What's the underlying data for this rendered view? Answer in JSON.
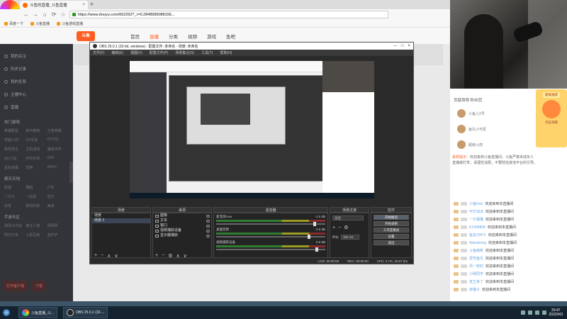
{
  "browser": {
    "tab_title": "斗鱼的直播_斗鱼直播",
    "tab_close": "×",
    "new_tab": "+",
    "url": "https://www.douyu.com/662262?_r=0.2848989088156...",
    "nav": {
      "back": "←",
      "forward": "→",
      "reload": "⟳",
      "home": "⌂",
      "star": "☆"
    },
    "bookmarks": [
      "百度一下",
      "斗鱼直播",
      "斗鱼游戏直播"
    ],
    "logo_caption": "斗鱼直播"
  },
  "site": {
    "logo": "斗鱼",
    "nav": [
      "首页",
      "直播",
      "分类",
      "视频",
      "游戏",
      "鱼吧"
    ],
    "active_nav": "直播"
  },
  "sidebar": {
    "items": [
      "我的关注",
      "历史记录",
      "我的任务",
      "主播中心",
      "直播"
    ],
    "section_1": "热门游戏",
    "grid_1": [
      "英雄联盟",
      "和平精英",
      "王者荣耀",
      "穿越火线",
      "CF手游",
      "DOTA2",
      "绝地求生",
      "主机游戏",
      "魔兽世界",
      "QQ飞车",
      "炉石传说",
      "DNF",
      "星际争霸",
      "原神",
      "APEX"
    ],
    "section_2": "娱乐天地",
    "grid_2": [
      "颜值",
      "舞蹈",
      "户外",
      "二次元",
      "一起看",
      "音乐",
      "体育",
      "数码科技",
      "美食"
    ],
    "section_3": "手游专区",
    "grid_3": [
      "球球大作战",
      "第五人格",
      "阴阳师",
      "明日方舟",
      "火影忍者",
      "金铲铲"
    ],
    "bottom_buttons": [
      "打开客户端",
      "下载"
    ]
  },
  "obs": {
    "title": "OBS 25.0.1 (32-bit, windows) - 配置文件: 未命名 - 场景: 未命名",
    "window_buttons": [
      "─",
      "□",
      "×"
    ],
    "menu": [
      "文件(F)",
      "编辑(E)",
      "视图(V)",
      "配置文件(P)",
      "场景集合(S)",
      "工具(T)",
      "帮助(H)"
    ],
    "docks": {
      "scenes": {
        "title": "场景",
        "items": [
          "场景",
          "场景 2"
        ]
      },
      "sources": {
        "title": "来源",
        "items": [
          "图像",
          "文本",
          "窗口",
          "视频捕获设备",
          "显示器捕获"
        ]
      },
      "mixer": {
        "title": "混音器",
        "channels": [
          {
            "name": "麦克风/Aux",
            "level": "-1.0 dB",
            "fader": 0.9
          },
          {
            "name": "桌面音频",
            "level": "-2.0 dB",
            "fader": 0.85
          },
          {
            "name": "视频捕获设备",
            "level": "0.0 dB",
            "fader": 0.92
          }
        ]
      },
      "transitions": {
        "title": "场景过渡",
        "selected": "淡出",
        "duration_label": "时长",
        "duration": "300 ms"
      },
      "controls": {
        "title": "控件",
        "buttons": [
          "开始推流",
          "开始录制",
          "工作室模式",
          "设置",
          "退出"
        ]
      }
    },
    "dock_tools": [
      "+",
      "−",
      "⚙",
      "∧",
      "∨"
    ],
    "status": [
      "LIVE: 00:00:00",
      "REC: 00:00:00",
      "CPU: 3.7%, 29.97 fps"
    ]
  },
  "chat": {
    "top_tabs": "贡献周榜  粉丝团",
    "fans": [
      "小鱼儿1号",
      "鱼丸小可爱",
      "超级火箭"
    ],
    "notice_label": "系统提示：",
    "notice_text": "欢迎来到斗鱼直播间，斗鱼严禁未成年人直播或打赏，请理性消费，不要轻信其他平台的引导。",
    "gift_ribbon": "超级福袋",
    "gift_label": "点击领取",
    "lines": [
      {
        "user": "小鱼Fish",
        "msg": "欢迎来到本直播间"
      },
      {
        "user": "可乐加冰",
        "msg": "欢迎来到本直播间"
      },
      {
        "user": "一只橘猫",
        "msg": "欢迎来到本直播间"
      },
      {
        "user": "K1999808",
        "msg": "欢迎来到本直播间"
      },
      {
        "user": "鱼友20471",
        "msg": "欢迎来到本直播间"
      },
      {
        "user": "Wandering",
        "msg": "欢迎来到本直播间"
      },
      {
        "user": "斗鱼萌新",
        "msg": "欢迎来到本直播间"
      },
      {
        "user": "爱吃鱼丸",
        "msg": "欢迎来到本直播间"
      },
      {
        "user": "风一样的",
        "msg": "欢迎来到本直播间"
      },
      {
        "user": "小明同学",
        "msg": "欢迎来到本直播间"
      },
      {
        "user": "老王来了",
        "msg": "欢迎来到本直播间"
      },
      {
        "user": "夜猫子",
        "msg": "欢迎来到本直播间"
      }
    ]
  },
  "taskbar": {
    "items": [
      "斗鱼直播_斗...",
      "OBS 25.0.1 (32-..."
    ],
    "time": "20:47",
    "date": "2022/4/3"
  }
}
